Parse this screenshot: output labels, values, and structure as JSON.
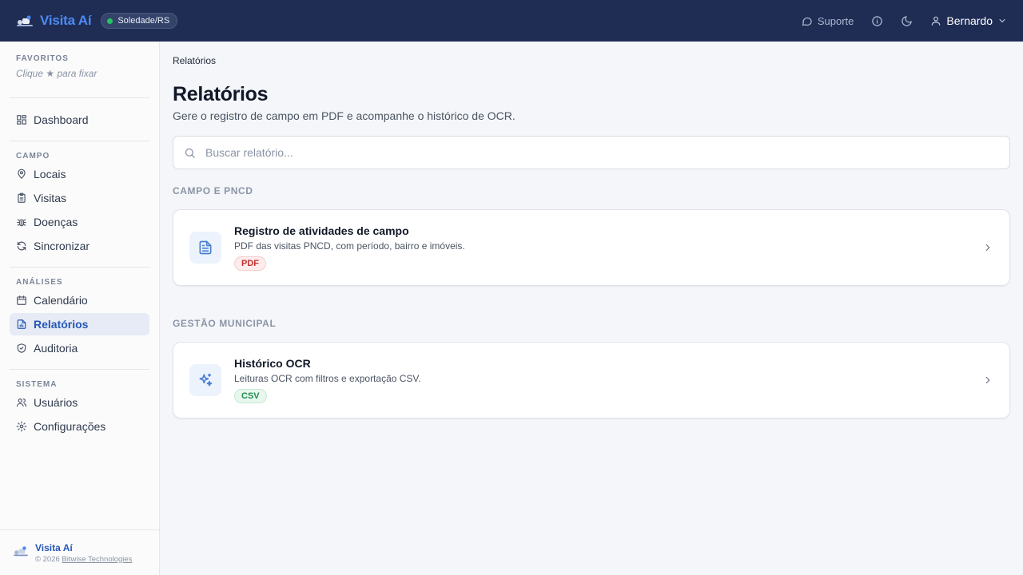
{
  "header": {
    "brand": "Visita Aí",
    "location": "Soledade/RS",
    "support_label": "Suporte",
    "user_name": "Bernardo"
  },
  "sidebar": {
    "favorites": {
      "title": "FAVORITOS",
      "hint": "Clique ★ para fixar"
    },
    "dashboard": "Dashboard",
    "sections": [
      {
        "title": "CAMPO",
        "items": [
          "Locais",
          "Visitas",
          "Doenças",
          "Sincronizar"
        ]
      },
      {
        "title": "ANÁLISES",
        "items": [
          "Calendário",
          "Relatórios",
          "Auditoria"
        ]
      },
      {
        "title": "SISTEMA",
        "items": [
          "Usuários",
          "Configurações"
        ]
      }
    ],
    "active_item": "Relatórios",
    "footer": {
      "name": "Visita Aí",
      "copyright": "© 2026",
      "company": "Bitwise Technologies"
    }
  },
  "main": {
    "breadcrumb": "Relatórios",
    "title": "Relatórios",
    "subtitle": "Gere o registro de campo em PDF e acompanhe o histórico de OCR.",
    "search_placeholder": "Buscar relatório...",
    "groups": [
      {
        "title": "CAMPO E PNCD",
        "card": {
          "title": "Registro de atividades de campo",
          "desc": "PDF das visitas PNCD, com período, bairro e imóveis.",
          "badge": "PDF"
        }
      },
      {
        "title": "GESTÃO MUNICIPAL",
        "card": {
          "title": "Histórico OCR",
          "desc": "Leituras OCR com filtros e exportação CSV.",
          "badge": "CSV"
        }
      }
    ]
  },
  "colors": {
    "topbar": "#1f2d55",
    "accent": "#2657b7",
    "brand": "#4d8bf5"
  }
}
